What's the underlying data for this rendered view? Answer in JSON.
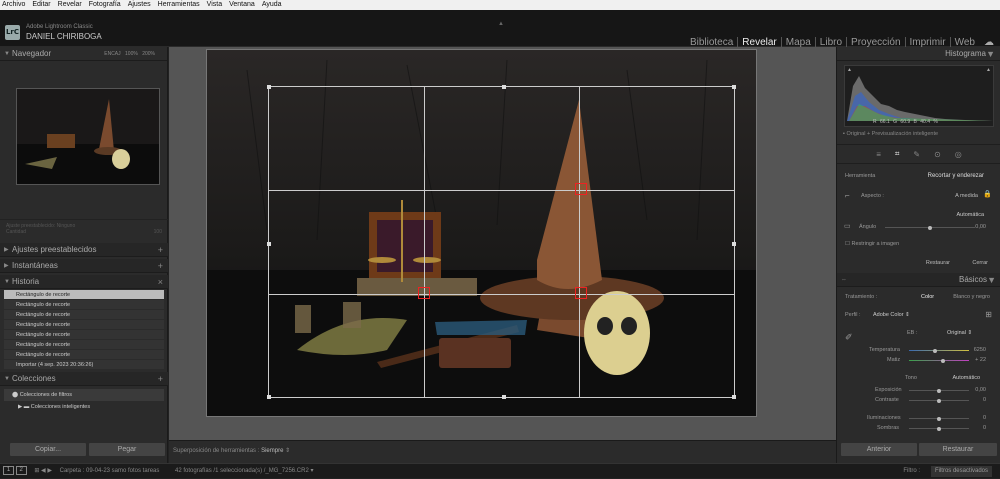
{
  "menu": [
    "Archivo",
    "Editar",
    "Revelar",
    "Fotografía",
    "Ajustes",
    "Herramientas",
    "Vista",
    "Ventana",
    "Ayuda"
  ],
  "app": {
    "name": "Adobe Lightroom Classic",
    "user": "DANIEL CHIRIBOGA",
    "logo": "LrC"
  },
  "modules": [
    "Biblioteca",
    "Revelar",
    "Mapa",
    "Libro",
    "Proyección",
    "Imprimir",
    "Web"
  ],
  "active_module": "Revelar",
  "left": {
    "navigator": {
      "title": "Navegador",
      "opts": "ENCAJ  100%  200%"
    },
    "presets_row": {
      "label": "Ajuste preestablecido:",
      "value": "Ninguno",
      "amount_label": "Cantidad",
      "amount_value": "100"
    },
    "sections": {
      "presets": "Ajustes preestablecidos",
      "snapshots": "Instantáneas",
      "history": "Historia",
      "collections": "Colecciones"
    },
    "history": [
      "Rectángulo de recorte",
      "Rectángulo de recorte",
      "Rectángulo de recorte",
      "Rectángulo de recorte",
      "Rectángulo de recorte",
      "Rectángulo de recorte",
      "Rectángulo de recorte",
      "Importar (4 sep. 2023 20:36:26)"
    ],
    "collections": {
      "filter": "Colecciones de filtros",
      "smart": "Colecciones inteligentes"
    },
    "copy_btn": "Copiar...",
    "paste_btn": "Pegar"
  },
  "toolbar": {
    "label": "Superposición de herramientas :",
    "value": "Siempre"
  },
  "filmstrip": {
    "p1": "1",
    "p2": "2",
    "folder": "Carpeta : 09-04-23 samo fotos tareas",
    "count": "42 fotografías /1 seleccionada(s) /_MG_7256.CR2",
    "filter_label": "Filtro :",
    "filter_value": "Filtros desactivados"
  },
  "right": {
    "histogram": {
      "title": "Histograma",
      "r_label": "R",
      "r": "66.1",
      "g_label": "G",
      "g": "60.9",
      "b_label": "B",
      "b": "40.4",
      "pct": "%",
      "preview": "Original + Previsualización inteligente"
    },
    "tools": {
      "label": "Herramienta",
      "title": "Recortar y enderezar"
    },
    "aspect": {
      "label": "Aspecto :",
      "value": "A medida"
    },
    "auto": "Automática",
    "angle": {
      "label": "Ángulo",
      "value": "0,00"
    },
    "constrain": "Restringir a imagen",
    "reset": "Restaurar",
    "close": "Cerrar",
    "basics": {
      "title": "Básicos",
      "treatment": "Tratamiento :",
      "color": "Color",
      "bw": "Blanco y negro",
      "profile_label": "Perfil :",
      "profile_value": "Adobe Color",
      "wb_label": "EB :",
      "wb_value": "Original",
      "temp_label": "Temperatura",
      "temp_value": "6250",
      "tint_label": "Matiz",
      "tint_value": "+ 22",
      "tone_label": "Tono",
      "tone_auto": "Automático",
      "exposure_label": "Exposición",
      "exposure_value": "0,00",
      "contrast_label": "Contraste",
      "contrast_value": "0",
      "highlights_label": "Iluminaciones",
      "highlights_value": "0",
      "shadows_label": "Sombras",
      "shadows_value": "0"
    },
    "prev_btn": "Anterior",
    "restore_btn": "Restaurar"
  },
  "colors": {
    "accent": "#e22222",
    "panel": "#2b2b2b",
    "workspace": "#555555"
  }
}
